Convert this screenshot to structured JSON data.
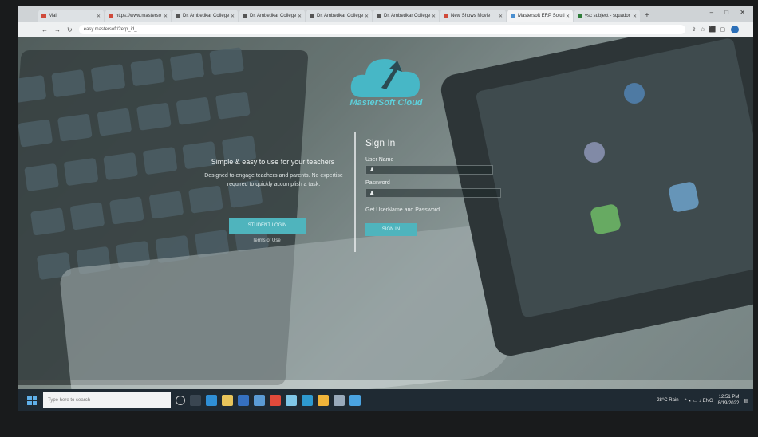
{
  "browser": {
    "tabs": [
      {
        "label": "Mail"
      },
      {
        "label": "https://www.masterso"
      },
      {
        "label": "Dr. Ambedkar College"
      },
      {
        "label": "Dr. Ambedkar College"
      },
      {
        "label": "Dr. Ambedkar College"
      },
      {
        "label": "Dr. Ambedkar College"
      },
      {
        "label": "New Shows Movie"
      },
      {
        "label": "Mastersoft ERP Soluti",
        "active": true
      },
      {
        "label": "ysc subject - squador"
      }
    ],
    "address": "easy.mastersoft/?erp_id_",
    "new_tab": "+",
    "window_controls": "– □ ✕"
  },
  "login": {
    "brand": "MasterSoft Cloud",
    "tagline": "Simple & easy to use for your teachers",
    "description": "Designed to engage teachers and parents. No expertise required to quickly accomplish a task.",
    "student_button": "STUDENT LOGIN",
    "terms": "Terms of Use",
    "signin_title": "Sign In",
    "username_label": "User Name",
    "password_label": "Password",
    "get_credentials": "Get UserName and Password",
    "signin_button": "SIGN IN"
  },
  "taskbar": {
    "search_placeholder": "Type here to search",
    "weather": "28°C Rain",
    "time": "12:51 PM",
    "date": "8/19/2022"
  },
  "colors": {
    "accent": "#4fb4bd",
    "brand": "#5ed0db"
  }
}
